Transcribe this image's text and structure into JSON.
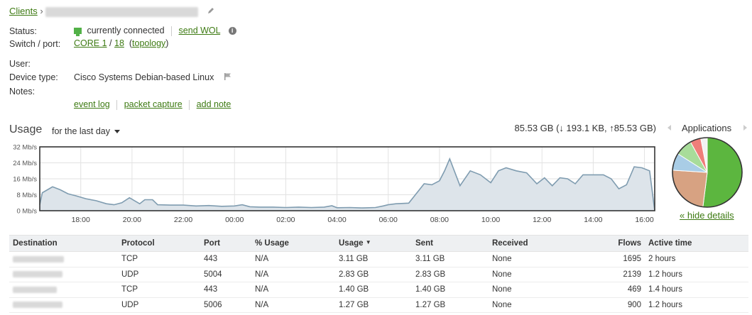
{
  "breadcrumb": {
    "root": "Clients",
    "separator": "›"
  },
  "status": {
    "label": "Status:",
    "value": "currently connected",
    "send_wol": "send WOL"
  },
  "switch_port": {
    "label": "Switch / port:",
    "switch": "CORE 1",
    "slash": "/",
    "port": "18",
    "topology": "topology"
  },
  "user": {
    "label": "User:"
  },
  "device_type": {
    "label": "Device type:",
    "value": "Cisco Systems Debian-based Linux"
  },
  "notes": {
    "label": "Notes:"
  },
  "actions": [
    "event log",
    "packet capture",
    "add note"
  ],
  "usage": {
    "title": "Usage",
    "period": "for the last day",
    "total_prefix": "85.53 GB (",
    "down_arrow": "↓",
    "down": " 193.1 KB, ",
    "up_arrow": "↑",
    "up": "85.53 GB)",
    "applications_label": "Applications",
    "hide_details": "« hide details"
  },
  "chart_data": {
    "type": "area",
    "xlabel": "",
    "ylabel": "",
    "ylim": [
      0,
      32
    ],
    "y_ticks": [
      "0 Mb/s",
      "8 Mb/s",
      "16 Mb/s",
      "24 Mb/s",
      "32 Mb/s"
    ],
    "x_ticks": [
      "18:00",
      "20:00",
      "22:00",
      "00:00",
      "02:00",
      "04:00",
      "06:00",
      "08:00",
      "10:00",
      "12:00",
      "14:00",
      "16:00"
    ],
    "x_start_hour": 16.4,
    "x_end_hour": 40.4,
    "grid": true,
    "fill_color": "#dde4ea",
    "line_color": "#7f9cb0",
    "series": [
      {
        "values": [
          [
            16.4,
            3
          ],
          [
            16.5,
            9
          ],
          [
            16.7,
            10.5
          ],
          [
            16.9,
            12
          ],
          [
            17.2,
            10.5
          ],
          [
            17.5,
            8.5
          ],
          [
            17.8,
            7.5
          ],
          [
            18.2,
            6
          ],
          [
            18.6,
            5
          ],
          [
            19.0,
            3.5
          ],
          [
            19.3,
            3
          ],
          [
            19.6,
            4
          ],
          [
            19.9,
            6.5
          ],
          [
            20.1,
            5
          ],
          [
            20.3,
            3.5
          ],
          [
            20.5,
            5.5
          ],
          [
            20.8,
            5.5
          ],
          [
            21.0,
            3
          ],
          [
            21.5,
            2.8
          ],
          [
            22.0,
            2.8
          ],
          [
            22.5,
            2.4
          ],
          [
            23.0,
            2.6
          ],
          [
            23.5,
            2.2
          ],
          [
            24.0,
            2.4
          ],
          [
            24.3,
            3
          ],
          [
            24.6,
            2
          ],
          [
            25.0,
            1.8
          ],
          [
            25.5,
            1.8
          ],
          [
            26.0,
            1.6
          ],
          [
            26.5,
            1.8
          ],
          [
            27.0,
            1.6
          ],
          [
            27.5,
            1.8
          ],
          [
            27.8,
            2.5
          ],
          [
            28.0,
            1.5
          ],
          [
            28.5,
            1.6
          ],
          [
            29.0,
            1.4
          ],
          [
            29.5,
            1.6
          ],
          [
            29.8,
            2.4
          ],
          [
            30.0,
            3
          ],
          [
            30.3,
            3.5
          ],
          [
            30.8,
            3.8
          ],
          [
            31.0,
            7
          ],
          [
            31.4,
            13.5
          ],
          [
            31.7,
            13
          ],
          [
            32.0,
            15
          ],
          [
            32.2,
            20
          ],
          [
            32.4,
            26
          ],
          [
            32.8,
            12.5
          ],
          [
            33.2,
            20
          ],
          [
            33.6,
            18
          ],
          [
            34.0,
            14
          ],
          [
            34.3,
            20
          ],
          [
            34.6,
            21.5
          ],
          [
            35.0,
            20
          ],
          [
            35.4,
            19
          ],
          [
            35.8,
            13.5
          ],
          [
            36.1,
            16.5
          ],
          [
            36.4,
            12.5
          ],
          [
            36.7,
            16.5
          ],
          [
            37.0,
            16
          ],
          [
            37.3,
            13.5
          ],
          [
            37.6,
            18
          ],
          [
            38.0,
            18
          ],
          [
            38.4,
            18
          ],
          [
            38.7,
            16
          ],
          [
            39.0,
            11
          ],
          [
            39.3,
            13
          ],
          [
            39.6,
            22
          ],
          [
            39.9,
            21.5
          ],
          [
            40.2,
            20
          ],
          [
            40.4,
            0
          ]
        ]
      }
    ]
  },
  "applications_pie": {
    "type": "pie",
    "slices": [
      {
        "value": 52,
        "color": "#5cb63f"
      },
      {
        "value": 24,
        "color": "#d7a282"
      },
      {
        "value": 8,
        "color": "#a9cde6"
      },
      {
        "value": 8,
        "color": "#a8dc9a"
      },
      {
        "value": 5,
        "color": "#ef7e7a"
      },
      {
        "value": 3,
        "color": "#f2f2f2"
      }
    ]
  },
  "table": {
    "headers": [
      "Destination",
      "Protocol",
      "Port",
      "% Usage",
      "Usage",
      "Sent",
      "Received",
      "Flows",
      "Active time"
    ],
    "sort_arrow": "▼",
    "rows": [
      {
        "protocol": "TCP",
        "port": "443",
        "pct": "N/A",
        "usage": "3.11 GB",
        "sent": "3.11 GB",
        "received": "None",
        "flows": "1695",
        "active": "2 hours"
      },
      {
        "protocol": "UDP",
        "port": "5004",
        "pct": "N/A",
        "usage": "2.83 GB",
        "sent": "2.83 GB",
        "received": "None",
        "flows": "2139",
        "active": "1.2 hours"
      },
      {
        "protocol": "TCP",
        "port": "443",
        "pct": "N/A",
        "usage": "1.40 GB",
        "sent": "1.40 GB",
        "received": "None",
        "flows": "469",
        "active": "1.4 hours"
      },
      {
        "protocol": "UDP",
        "port": "5006",
        "pct": "N/A",
        "usage": "1.27 GB",
        "sent": "1.27 GB",
        "received": "None",
        "flows": "900",
        "active": "1.2 hours"
      }
    ]
  }
}
